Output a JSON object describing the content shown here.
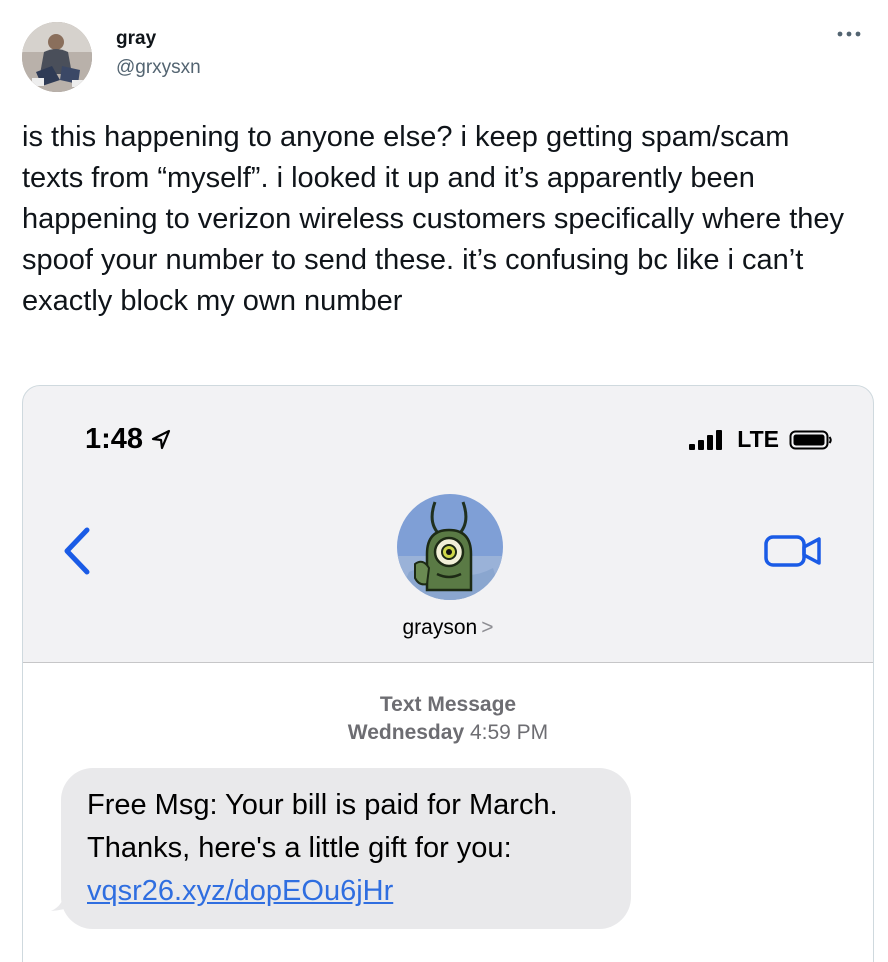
{
  "author": {
    "display_name": "gray",
    "handle": "@grxysxn"
  },
  "tweet": {
    "text": "is this happening to anyone else? i keep getting spam/scam texts from “myself”. i looked it up and it’s apparently been happening to verizon wireless customers specifically where they spoof your number to send these. it’s confusing bc like i can’t exactly block my own number"
  },
  "icons": {
    "more": "more-horizontal-icon",
    "location": "location-arrow-icon",
    "signal": "cellular-signal-icon",
    "battery": "battery-icon",
    "back": "chevron-left-icon",
    "video": "video-camera-icon"
  },
  "phone": {
    "status_time": "1:48",
    "network": "LTE",
    "contact_name": "grayson",
    "contact_chevron": ">",
    "message_type": "Text Message",
    "message_day": "Wednesday",
    "message_time": "4:59 PM",
    "message_text": "Free Msg: Your bill is paid for March. Thanks, here's a little gift for you: ",
    "message_link": "vqsr26.xyz/dopEOu6jHr"
  },
  "colors": {
    "text_primary": "#0f1419",
    "text_secondary": "#536471",
    "ios_blue": "#1a5be6",
    "bubble_gray": "#e9e9eb",
    "link_blue": "#2f6ee0"
  }
}
